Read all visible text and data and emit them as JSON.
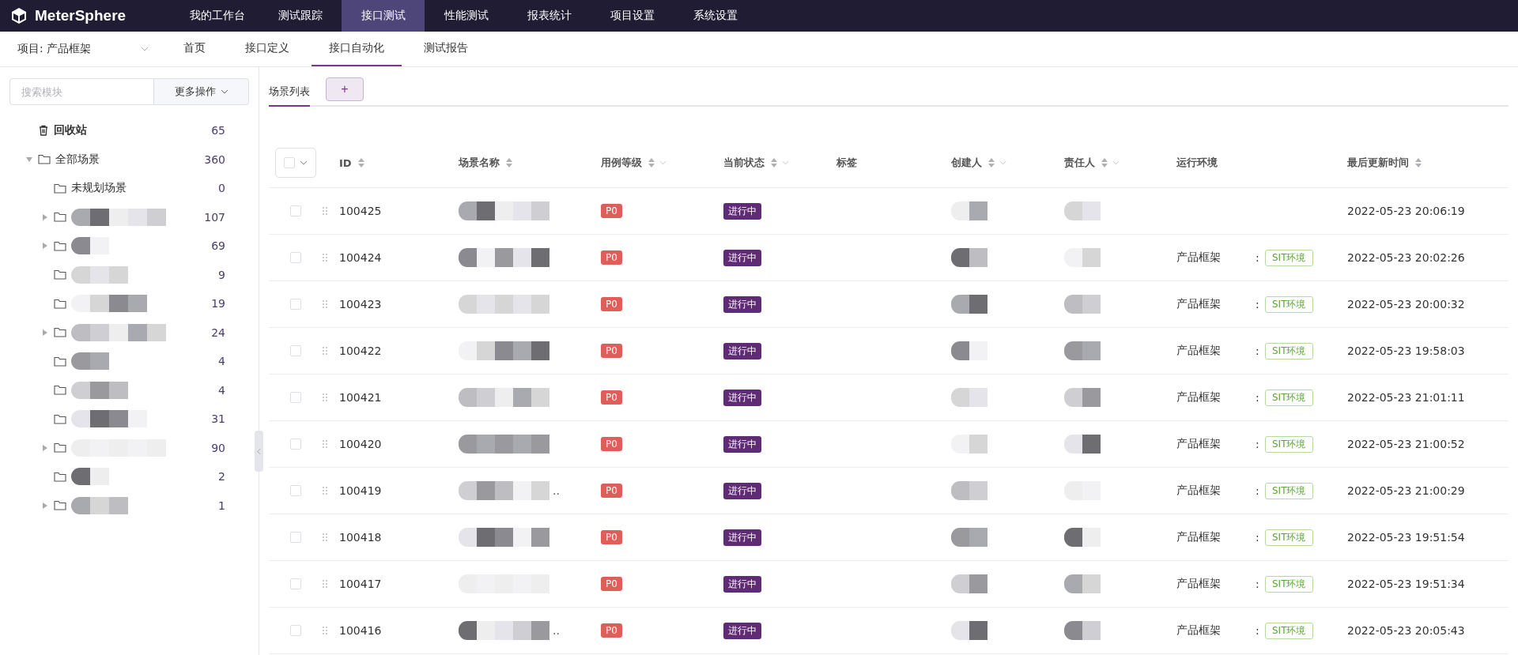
{
  "brand": "MeterSphere",
  "nav": [
    {
      "label": "我的工作台",
      "selected": false
    },
    {
      "label": "测试跟踪",
      "selected": false
    },
    {
      "label": "接口测试",
      "selected": true
    },
    {
      "label": "性能测试",
      "selected": false
    },
    {
      "label": "报表统计",
      "selected": false
    },
    {
      "label": "项目设置",
      "selected": false
    },
    {
      "label": "系统设置",
      "selected": false
    }
  ],
  "project": "项目: 产品框架",
  "subnav": [
    {
      "label": "首页",
      "selected": false
    },
    {
      "label": "接口定义",
      "selected": false
    },
    {
      "label": "接口自动化",
      "selected": true
    },
    {
      "label": "测试报告",
      "selected": false
    }
  ],
  "sidebar": {
    "search": {
      "placeholder": "搜索模块"
    },
    "more_button": "更多操作",
    "tree": [
      {
        "kind": "trash",
        "label": "回收站",
        "count": "65"
      },
      {
        "kind": "folder",
        "label": "全部场景",
        "count": "360",
        "expanded": true,
        "children": [
          {
            "kind": "folder",
            "label": "未规划场景",
            "count": "0"
          },
          {
            "kind": "blurred",
            "count": "107",
            "expanded": false
          },
          {
            "kind": "blurred",
            "count": "69",
            "expanded": false
          },
          {
            "kind": "blurred",
            "count": "9"
          },
          {
            "kind": "blurred",
            "count": "19"
          },
          {
            "kind": "blurred",
            "count": "24",
            "expanded": false
          },
          {
            "kind": "blurred",
            "count": "4"
          },
          {
            "kind": "blurred",
            "count": "4"
          },
          {
            "kind": "blurred",
            "count": "31"
          },
          {
            "kind": "blurred",
            "count": "90",
            "expanded": false
          },
          {
            "kind": "blurred",
            "count": "2"
          },
          {
            "kind": "blurred",
            "count": "1",
            "expanded": false
          }
        ]
      }
    ]
  },
  "tabs": [
    {
      "label": "场景列表",
      "selected": true
    }
  ],
  "add_button": "+",
  "table": {
    "columns": [
      {
        "label": "ID",
        "sortable": true,
        "filterable": false
      },
      {
        "label": "场景名称",
        "sortable": true,
        "filterable": false
      },
      {
        "label": "用例等级",
        "sortable": true,
        "filterable": true
      },
      {
        "label": "当前状态",
        "sortable": true,
        "filterable": true
      },
      {
        "label": "标签",
        "sortable": false,
        "filterable": false
      },
      {
        "label": "创建人",
        "sortable": true,
        "filterable": true
      },
      {
        "label": "责任人",
        "sortable": true,
        "filterable": true
      },
      {
        "label": "运行环境",
        "sortable": false,
        "filterable": false
      },
      {
        "label": "最后更新时间",
        "sortable": true,
        "filterable": false
      }
    ],
    "rows": [
      {
        "checked": false,
        "id": "100425",
        "level": "P0",
        "status": "进行中",
        "updated": "2022-05-23 20:06:19"
      },
      {
        "checked": false,
        "id": "100424",
        "level": "P0",
        "status": "进行中",
        "env_project": "产品框架",
        "env_sep": ":",
        "env": "SIT环境",
        "updated": "2022-05-23 20:02:26"
      },
      {
        "checked": false,
        "id": "100423",
        "level": "P0",
        "status": "进行中",
        "env_project": "产品框架",
        "env_sep": ":",
        "env": "SIT环境",
        "updated": "2022-05-23 20:00:32"
      },
      {
        "checked": false,
        "id": "100422",
        "level": "P0",
        "status": "进行中",
        "env_project": "产品框架",
        "env_sep": ":",
        "env": "SIT环境",
        "updated": "2022-05-23 19:58:03"
      },
      {
        "checked": false,
        "id": "100421",
        "level": "P0",
        "status": "进行中",
        "env_project": "产品框架",
        "env_sep": ":",
        "env": "SIT环境",
        "updated": "2022-05-23 21:01:11"
      },
      {
        "checked": false,
        "id": "100420",
        "level": "P0",
        "status": "进行中",
        "env_project": "产品框架",
        "env_sep": ":",
        "env": "SIT环境",
        "updated": "2022-05-23 21:00:52"
      },
      {
        "checked": false,
        "id": "100419",
        "name_tail": "..",
        "level": "P0",
        "status": "进行中",
        "env_project": "产品框架",
        "env_sep": ":",
        "env": "SIT环境",
        "updated": "2022-05-23 21:00:29"
      },
      {
        "checked": false,
        "id": "100418",
        "level": "P0",
        "status": "进行中",
        "env_project": "产品框架",
        "env_sep": ":",
        "env": "SIT环境",
        "updated": "2022-05-23 19:51:54"
      },
      {
        "checked": false,
        "id": "100417",
        "level": "P0",
        "status": "进行中",
        "env_project": "产品框架",
        "env_sep": ":",
        "env": "SIT环境",
        "updated": "2022-05-23 19:51:34"
      },
      {
        "checked": false,
        "id": "100416",
        "name_tail": "..",
        "level": "P0",
        "status": "进行中",
        "env_project": "产品框架",
        "env_sep": ":",
        "env": "SIT环境",
        "updated": "2022-05-23 20:05:43"
      }
    ]
  }
}
